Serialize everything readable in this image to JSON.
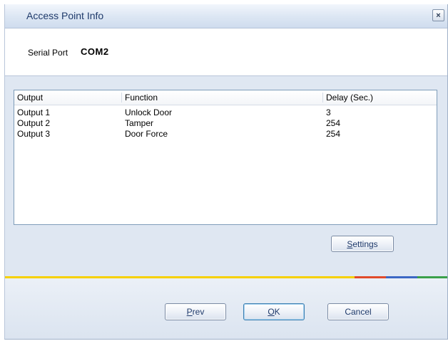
{
  "window": {
    "title": "Access Point Info"
  },
  "header": {
    "serial_label": "Serial Port",
    "serial_value": "COM2"
  },
  "table": {
    "columns": [
      "Output",
      "Function",
      "Delay (Sec.)"
    ],
    "rows": [
      [
        "Output 1",
        "Unlock Door",
        "3"
      ],
      [
        "Output 2",
        "Tamper",
        "254"
      ],
      [
        "Output 3",
        "Door Force",
        "254"
      ]
    ]
  },
  "buttons": {
    "settings": "Settings",
    "prev": "Prev",
    "ok": "OK",
    "cancel": "Cancel",
    "close_glyph": "×"
  },
  "colors": {
    "stripe": [
      "#f6d000",
      "#e04a2a",
      "#3b67c4",
      "#3aa04a"
    ]
  }
}
